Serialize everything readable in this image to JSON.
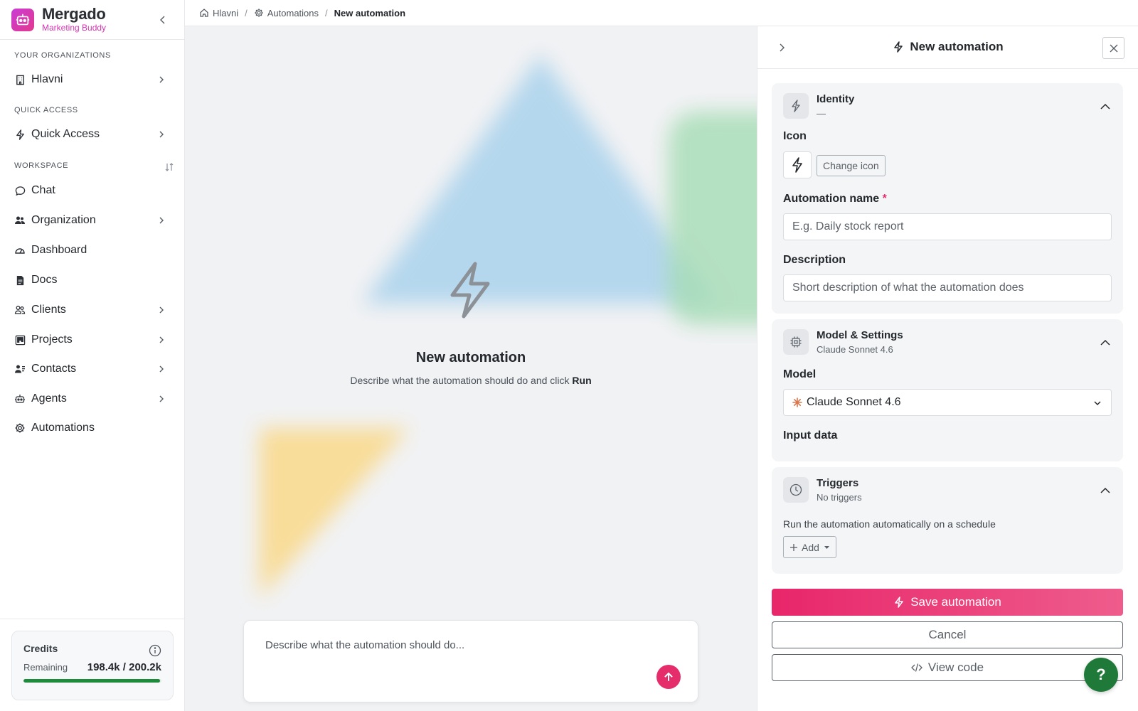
{
  "brand": {
    "name": "Mergado",
    "subtitle": "Marketing Buddy"
  },
  "sidebar": {
    "sections": {
      "organizations": "YOUR ORGANIZATIONS",
      "quick_access": "QUICK ACCESS",
      "workspace": "WORKSPACE"
    },
    "org_item": {
      "label": "Hlavni",
      "icon": "building-icon"
    },
    "quick_item": {
      "label": "Quick Access",
      "icon": "bolt-icon"
    },
    "items": [
      {
        "label": "Chat",
        "icon": "chat-icon",
        "chevron": false
      },
      {
        "label": "Organization",
        "icon": "users-icon",
        "chevron": true
      },
      {
        "label": "Dashboard",
        "icon": "gauge-icon",
        "chevron": false
      },
      {
        "label": "Docs",
        "icon": "document-icon",
        "chevron": false
      },
      {
        "label": "Clients",
        "icon": "clients-icon",
        "chevron": true
      },
      {
        "label": "Projects",
        "icon": "kanban-icon",
        "chevron": true
      },
      {
        "label": "Contacts",
        "icon": "contacts-icon",
        "chevron": true
      },
      {
        "label": "Agents",
        "icon": "robot-icon",
        "chevron": true
      },
      {
        "label": "Automations",
        "icon": "gear-icon",
        "chevron": false
      }
    ]
  },
  "credits": {
    "title": "Credits",
    "remaining_label": "Remaining",
    "value": "198.4k / 200.2k",
    "fraction_used_remaining": 0.991
  },
  "breadcrumb": {
    "home": "Hlavni",
    "automations": "Automations",
    "current": "New automation"
  },
  "hero": {
    "title": "New automation",
    "subtitle_prefix": "Describe what the automation should do and click ",
    "subtitle_bold": "Run"
  },
  "prompt": {
    "placeholder": "Describe what the automation should do..."
  },
  "panel": {
    "title": "New automation",
    "identity": {
      "title": "Identity",
      "sub": "—",
      "icon_label": "Icon",
      "change_icon": "Change icon",
      "name_label": "Automation name",
      "required_mark": "*",
      "name_placeholder": "E.g. Daily stock report",
      "desc_label": "Description",
      "desc_placeholder": "Short description of what the automation does"
    },
    "model": {
      "title": "Model & Settings",
      "sub": "Claude Sonnet 4.6",
      "model_label": "Model",
      "model_value": "Claude Sonnet 4.6",
      "input_label": "Input data"
    },
    "triggers": {
      "title": "Triggers",
      "sub": "No triggers",
      "helper": "Run the automation automatically on a schedule",
      "add": "Add"
    },
    "save": "Save automation",
    "cancel": "Cancel",
    "view_code": "View code"
  },
  "help": {
    "label": "?"
  },
  "colors": {
    "accent": "#e62d6c",
    "brand": "#d535b2",
    "credits_bar": "#1e8a3c",
    "help": "#1f7a3a"
  }
}
